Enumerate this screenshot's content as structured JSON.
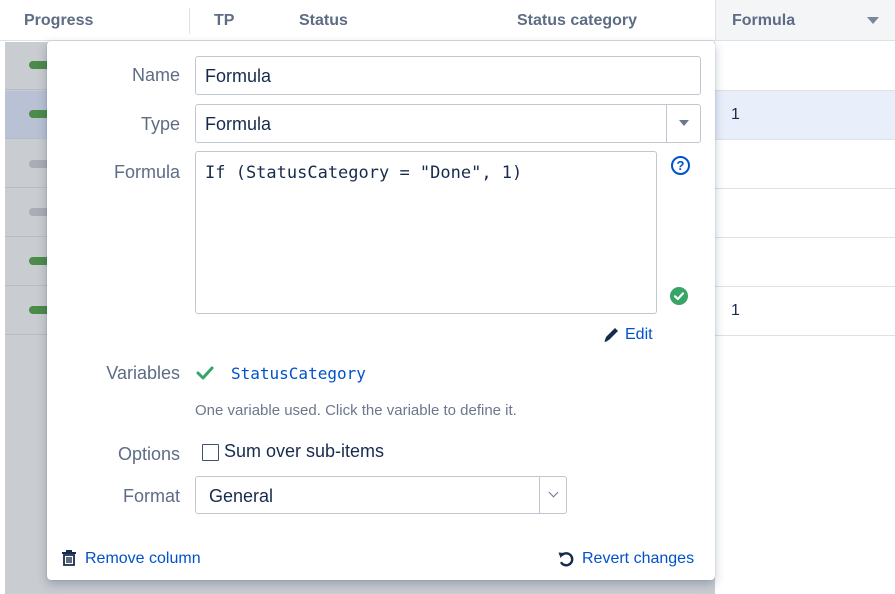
{
  "grid": {
    "columns": [
      "Progress",
      "TP",
      "Status",
      "Status category"
    ],
    "formula_column": "Formula",
    "formula_values": [
      "",
      "1",
      "",
      "",
      "",
      "1"
    ]
  },
  "dialog": {
    "name_label": "Name",
    "name_value": "Formula",
    "type_label": "Type",
    "type_value": "Formula",
    "formula_label": "Formula",
    "formula_value": "If (StatusCategory = \"Done\", 1)",
    "help_glyph": "?",
    "edit_label": "Edit",
    "variables_label": "Variables",
    "variable_name": "StatusCategory",
    "variables_hint": "One variable used. Click the variable to define it.",
    "options_label": "Options",
    "sum_option_label": "Sum over sub-items",
    "sum_option_checked": false,
    "format_label": "Format",
    "format_value": "General",
    "remove_label": "Remove column",
    "revert_label": "Revert changes"
  },
  "colors": {
    "accent": "#0052cc",
    "valid": "#36a566",
    "progress_done": "#4c8b49",
    "progress_todo": "#a9adb4"
  },
  "icons": [
    "help-icon",
    "check-circle-icon",
    "pencil-icon",
    "check-icon",
    "trash-icon",
    "undo-icon",
    "sort-caret-icon",
    "select-caret-icon",
    "select-chevron-icon"
  ]
}
